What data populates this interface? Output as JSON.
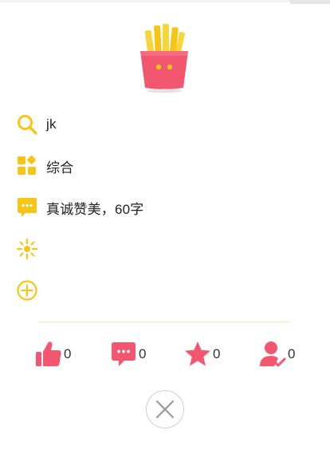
{
  "colors": {
    "accent_yellow": "#f5c518",
    "accent_pink": "#f2576f",
    "divider": "#fbe7a8"
  },
  "logo": {
    "icon": "french-fries-icon"
  },
  "info_rows": [
    {
      "icon": "search-icon",
      "label": "jk"
    },
    {
      "icon": "category-grid-icon",
      "label": "综合"
    },
    {
      "icon": "comment-bubble-icon",
      "label": "真诚赞美，60字"
    },
    {
      "icon": "sparkle-icon",
      "label": ""
    },
    {
      "icon": "add-circle-icon",
      "label": ""
    }
  ],
  "stats": [
    {
      "icon": "thumbs-up-icon",
      "count": "0"
    },
    {
      "icon": "comment-icon",
      "count": "0"
    },
    {
      "icon": "star-icon",
      "count": "0"
    },
    {
      "icon": "user-check-icon",
      "count": "0"
    }
  ],
  "close": {
    "icon": "close-icon"
  }
}
